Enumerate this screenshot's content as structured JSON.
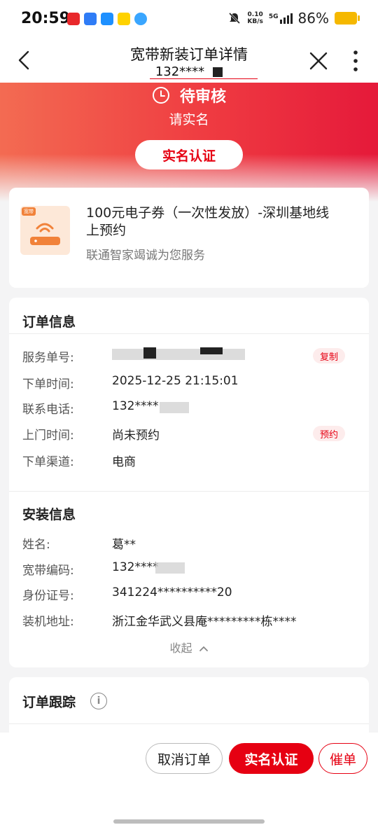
{
  "status_bar": {
    "time": "20:59",
    "net_speed_value": "0.10",
    "net_speed_unit": "KB/s",
    "network": "5G",
    "battery": "86%",
    "app_icons": [
      "red-app-icon",
      "blue-app-icon",
      "blue-browser-icon",
      "yellow-app-icon",
      "messenger-icon"
    ],
    "colors": {
      "battery": "#f5b800"
    }
  },
  "header": {
    "title": "宽带新装订单详情",
    "subtitle": "132****"
  },
  "hero": {
    "status": "待审核",
    "status_icon": "clock-icon",
    "sub": "请实名",
    "verify_button": "实名认证",
    "colors": {
      "start": "#f36b52",
      "end": "#e5193a"
    }
  },
  "product": {
    "tag": "宽带",
    "title": "100元电子券（一次性发放）-深圳基地线上预约",
    "subtitle": "联通智家竭诚为您服务",
    "icon": "router-icon"
  },
  "order_info": {
    "title": "订单信息",
    "rows": [
      {
        "label": "服务单号:",
        "value": "",
        "action": "复制"
      },
      {
        "label": "下单时间:",
        "value": "2025-12-25 21:15:01",
        "action": ""
      },
      {
        "label": "联系电话:",
        "value": "132****",
        "action": ""
      },
      {
        "label": "上门时间:",
        "value": "尚未预约",
        "action": "预约"
      },
      {
        "label": "下单渠道:",
        "value": "电商",
        "action": ""
      }
    ]
  },
  "install_info": {
    "title": "安装信息",
    "rows": [
      {
        "label": "姓名:",
        "value": "葛**"
      },
      {
        "label": "宽带编码:",
        "value": "132****"
      },
      {
        "label": "身份证号:",
        "value": "341224**********20"
      },
      {
        "label": "装机地址:",
        "value": "浙江金华武义县庵*********栋****"
      }
    ],
    "collapse": "收起"
  },
  "tracking": {
    "title": "订单跟踪",
    "info_icon": "info-icon"
  },
  "bottom": {
    "cancel": "取消订单",
    "verify": "实名认证",
    "urge": "催单",
    "accent": "#e60012"
  }
}
